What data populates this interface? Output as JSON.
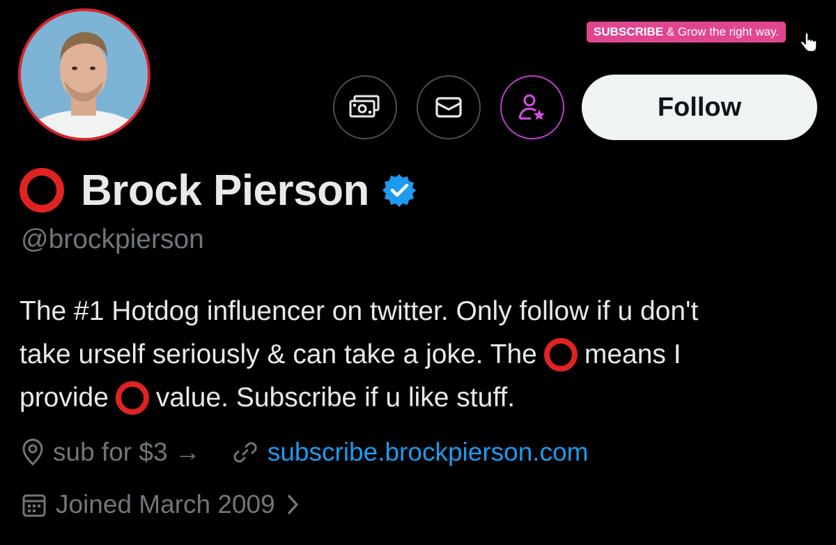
{
  "promo": {
    "strong": "SUBSCRIBE",
    "rest": "& Grow the right way."
  },
  "actions": {
    "tip_icon": "money-icon",
    "message_icon": "envelope-icon",
    "subscribe_icon": "person-star-icon",
    "follow_label": "Follow"
  },
  "profile": {
    "display_name": "Brock Pierson",
    "verified_icon": "verified-badge-icon",
    "handle": "@brockpierson",
    "bio": {
      "line1": "The #1 Hotdog influencer on twitter. Only follow if u don't",
      "line2a": "take urself seriously & can take a joke. The",
      "line2b": "means I",
      "line3a": "provide",
      "line3b": "value. Subscribe if u like stuff."
    },
    "location": "sub for $3 →",
    "website": "subscribe.brockpierson.com",
    "joined": "Joined March 2009"
  },
  "colors": {
    "background": "#000000",
    "follow_bg": "#eff3f4",
    "link": "#1d9bf0",
    "promo": "#e0468f",
    "ring": "#e12222",
    "subscribe_border": "#c23fcf"
  }
}
